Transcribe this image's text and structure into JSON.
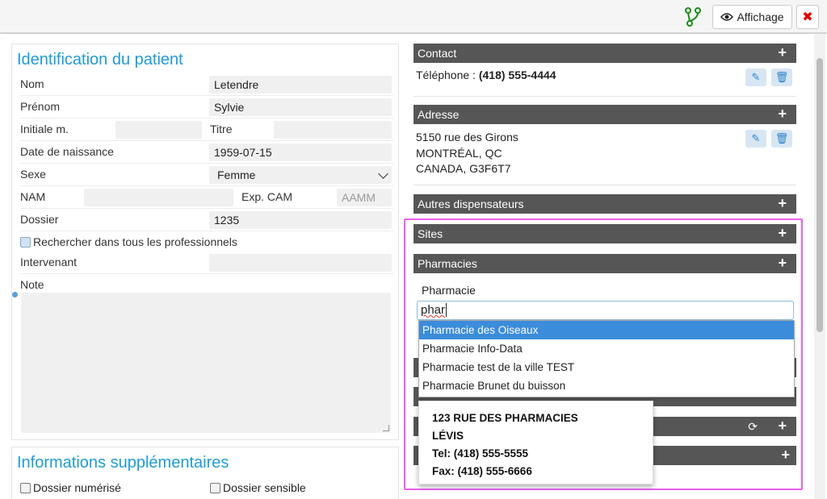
{
  "toolbar": {
    "display_label": "Affichage"
  },
  "identification": {
    "title": "Identification du patient",
    "nom_label": "Nom",
    "nom_value": "Letendre",
    "prenom_label": "Prénom",
    "prenom_value": "Sylvie",
    "initiale_label": "Initiale m.",
    "titre_label": "Titre",
    "ddn_label": "Date de naissance",
    "ddn_value": "1959-07-15",
    "sexe_label": "Sexe",
    "sexe_value": "Femme",
    "nam_label": "NAM",
    "expcam_label": "Exp. CAM",
    "expcam_placeholder": "AAMM",
    "dossier_label": "Dossier",
    "dossier_value": "1235",
    "search_all_label": "Rechercher dans tous les professionnels",
    "intervenant_label": "Intervenant",
    "note_label": "Note"
  },
  "supplementary": {
    "title": "Informations supplémentaires",
    "dossier_numerise": "Dossier numérisé",
    "dossier_sensible": "Dossier sensible"
  },
  "contact": {
    "header": "Contact",
    "phone_label": "Téléphone :",
    "phone_value": "(418) 555-4444"
  },
  "adresse": {
    "header": "Adresse",
    "line1": "5150 rue des Girons",
    "line2": "MONTRÉAL, QC",
    "line3": "CANADA, G3F6T7"
  },
  "autres": {
    "header": "Autres dispensateurs"
  },
  "sites": {
    "header": "Sites"
  },
  "pharmacies": {
    "header": "Pharmacies",
    "field_label": "Pharmacie",
    "input_value": "phar",
    "options": [
      "Pharmacie des Oiseaux",
      "Pharmacie Info-Data",
      "Pharmacie test de la ville TEST",
      "Pharmacie Brunet du buisson"
    ],
    "selected_index": 0
  },
  "tooltip": {
    "line1": "123 RUE DES PHARMACIES",
    "line2": "LÉVIS",
    "line3": "Tel: (418) 555-5555",
    "line4": "Fax: (418) 555-6666"
  },
  "colors": {
    "accent": "#1f9bd7",
    "header_bg": "#565656",
    "highlight": "#ea5ff0",
    "selected": "#3b8cdb"
  },
  "icons": [
    "branch-icon",
    "eye-icon",
    "close-icon",
    "plus-icon",
    "edit-icon",
    "trash-icon",
    "refresh-icon",
    "chevron-down-icon",
    "info-icon"
  ]
}
